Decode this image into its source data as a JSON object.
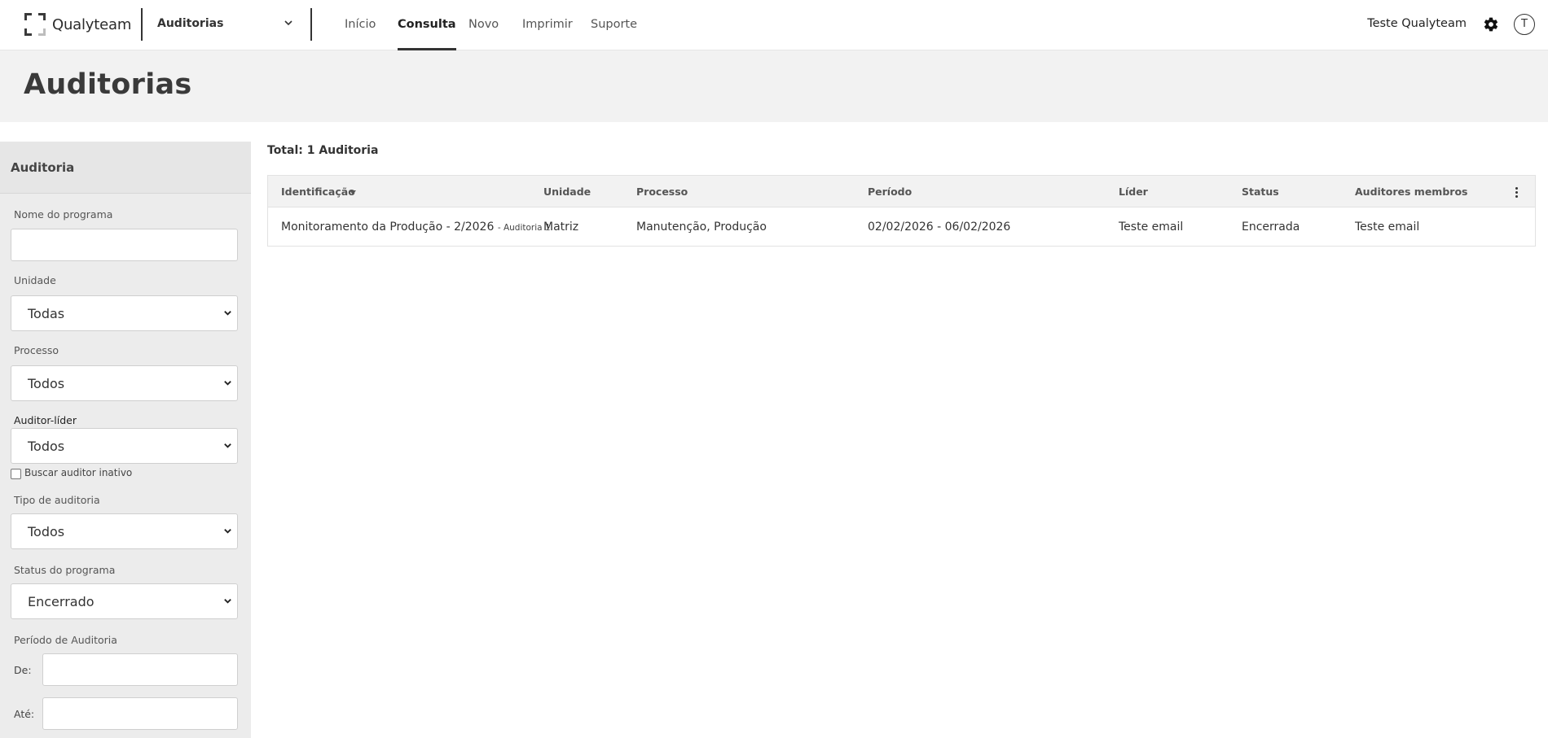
{
  "app": {
    "logo_text": "Qualyteam",
    "module": "Auditorias"
  },
  "nav": [
    "Início",
    "Consulta",
    "Novo",
    "Imprimir",
    "Suporte"
  ],
  "nav_active": "Consulta",
  "user": {
    "name": "Teste Qualyteam",
    "initial": "T"
  },
  "page": {
    "title": "Auditorias"
  },
  "filters": {
    "title": "Auditoria",
    "program_name_label": "Nome do programa",
    "program_name_value": "",
    "unit_label": "Unidade",
    "unit_value": "Todas",
    "process_label": "Processo",
    "process_value": "Todos",
    "lead_label": "Auditor-líder",
    "lead_value": "Todos",
    "inactive_label": "Buscar auditor inativo",
    "inactive_checked": false,
    "type_label": "Tipo de auditoria",
    "type_value": "Todos",
    "status_label": "Status do programa",
    "status_value": "Encerrado",
    "period_label": "Período de Auditoria",
    "from_label": "De:",
    "to_label": "Até:",
    "from_value": "",
    "to_value": ""
  },
  "results": {
    "total": "Total: 1 Auditoria",
    "columns": [
      "Identificação",
      "Unidade",
      "Processo",
      "Período",
      "Líder",
      "Status",
      "Auditores membros"
    ],
    "rows": [
      {
        "id": "Monitoramento da Produção - 2/2026",
        "id_suffix": "- Auditoria 1",
        "unit": "Matriz",
        "process": "Manutenção, Produção",
        "period": "02/02/2026 - 06/02/2026",
        "leader": "Teste email",
        "status": "Encerrada",
        "members": "Teste email"
      }
    ]
  },
  "icons": {
    "gear": "gear-icon",
    "chevron": "chevron-down-icon",
    "kebab": "kebab-menu-icon",
    "sort": "sort-desc-icon"
  }
}
